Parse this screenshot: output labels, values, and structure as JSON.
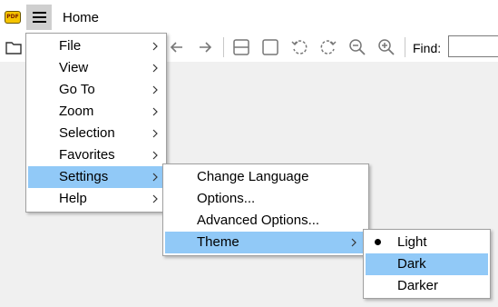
{
  "window": {
    "title": "Home",
    "app_icon_text": "PDF"
  },
  "toolbar": {
    "icons": [
      "open-folder-icon",
      "back-icon",
      "forward-icon",
      "fit-width-icon",
      "fit-page-icon",
      "rotate-left-icon",
      "rotate-right-icon",
      "zoom-out-icon",
      "zoom-in-icon"
    ],
    "find_label": "Find:",
    "find_value": ""
  },
  "main_menu": {
    "items": [
      {
        "label": "File"
      },
      {
        "label": "View"
      },
      {
        "label": "Go To"
      },
      {
        "label": "Zoom"
      },
      {
        "label": "Selection"
      },
      {
        "label": "Favorites"
      },
      {
        "label": "Settings",
        "highlighted": true
      },
      {
        "label": "Help"
      }
    ]
  },
  "settings_menu": {
    "items": [
      {
        "label": "Change Language"
      },
      {
        "label": "Options..."
      },
      {
        "label": "Advanced Options..."
      },
      {
        "label": "Theme",
        "highlighted": true
      }
    ]
  },
  "theme_menu": {
    "items": [
      {
        "label": "Light",
        "checked": true
      },
      {
        "label": "Dark",
        "highlighted": true
      },
      {
        "label": "Darker"
      }
    ]
  },
  "colors": {
    "highlight": "#91c9f7",
    "menu_bg": "#ffffff",
    "workspace_bg": "#f0f0f0"
  }
}
